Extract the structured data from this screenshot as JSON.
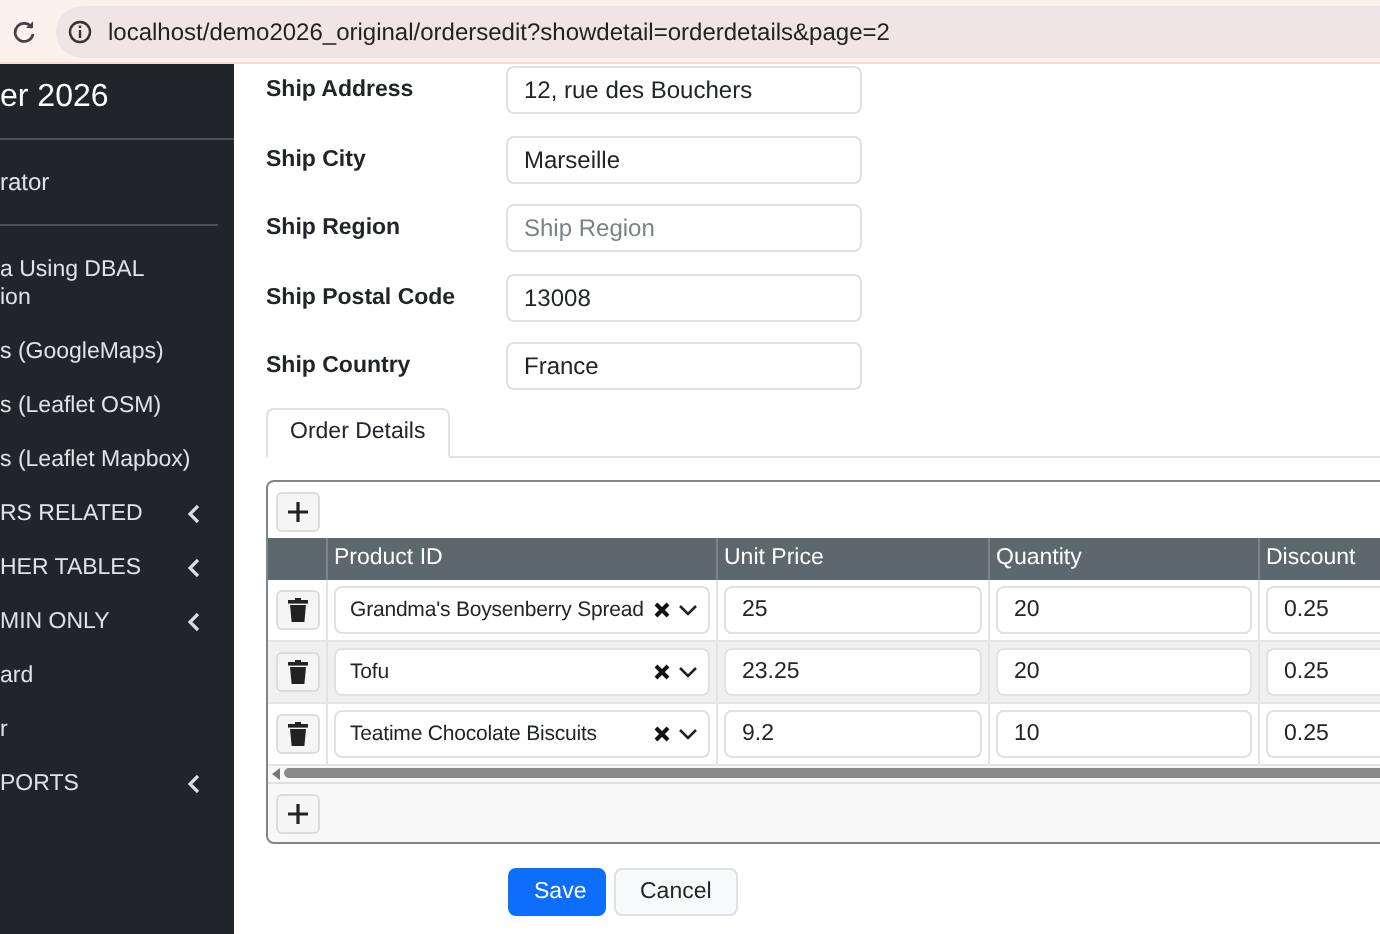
{
  "browser": {
    "url": "localhost/demo2026_original/ordersedit?showdetail=orderdetails&page=2"
  },
  "sidebar": {
    "brand": "er 2026",
    "user": "rator",
    "items": [
      {
        "lines": [
          "a Using DBAL",
          "ion"
        ],
        "expandable": false
      },
      {
        "lines": [
          "s (GoogleMaps)"
        ],
        "expandable": false
      },
      {
        "lines": [
          "s (Leaflet OSM)"
        ],
        "expandable": false
      },
      {
        "lines": [
          "s (Leaflet Mapbox)"
        ],
        "expandable": false
      },
      {
        "lines": [
          "RS RELATED"
        ],
        "expandable": true
      },
      {
        "lines": [
          "HER TABLES"
        ],
        "expandable": true
      },
      {
        "lines": [
          "MIN ONLY"
        ],
        "expandable": true
      },
      {
        "lines": [
          "ard"
        ],
        "expandable": false
      },
      {
        "lines": [
          "r"
        ],
        "expandable": false
      },
      {
        "lines": [
          "PORTS"
        ],
        "expandable": true
      }
    ]
  },
  "form": {
    "fields": [
      {
        "label": "Ship Address",
        "value": "12, rue des Bouchers"
      },
      {
        "label": "Ship City",
        "value": "Marseille"
      },
      {
        "label": "Ship Region",
        "placeholder": "Ship Region"
      },
      {
        "label": "Ship Postal Code",
        "value": "13008"
      },
      {
        "label": "Ship Country",
        "value": "France"
      }
    ]
  },
  "tabs": [
    {
      "label": "Order Details",
      "selected": true
    }
  ],
  "grid": {
    "columns": [
      "Product ID",
      "Unit Price",
      "Quantity",
      "Discount"
    ],
    "rows": [
      {
        "product": "Grandma's Boysenberry Spread",
        "unit_price": "25",
        "quantity": "20",
        "discount": "0.25"
      },
      {
        "product": "Tofu",
        "unit_price": "23.25",
        "quantity": "20",
        "discount": "0.25"
      },
      {
        "product": "Teatime Chocolate Biscuits",
        "unit_price": "9.2",
        "quantity": "10",
        "discount": "0.25"
      }
    ]
  },
  "buttons": [
    {
      "label": "Save",
      "kind": "primary"
    },
    {
      "label": "Cancel",
      "kind": "secondary"
    }
  ]
}
